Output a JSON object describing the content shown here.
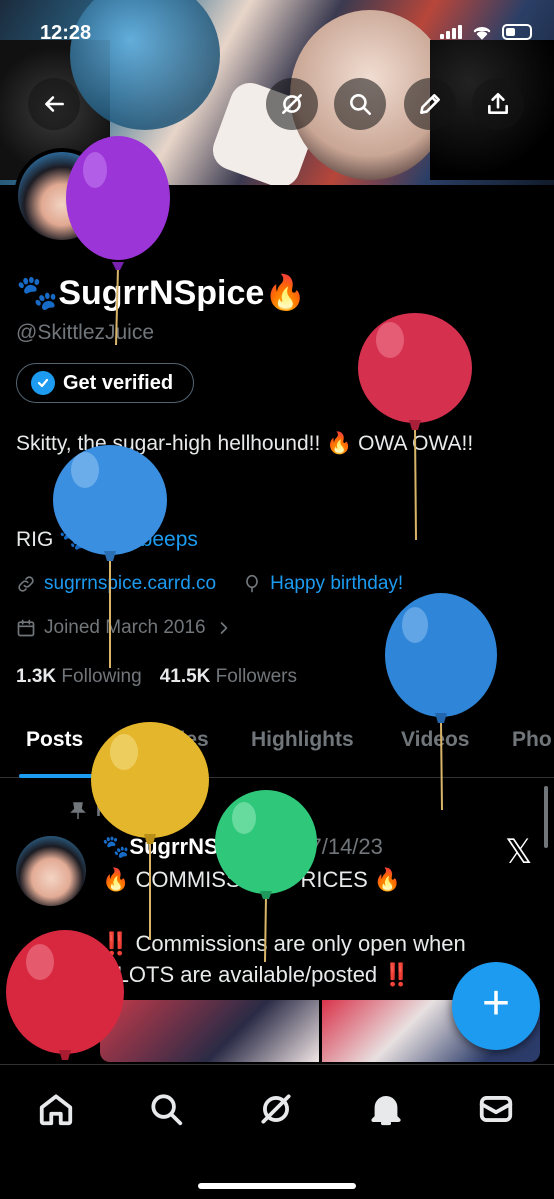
{
  "status_bar": {
    "time": "12:28"
  },
  "profile": {
    "name": "🐾SugrrNSpice🔥",
    "handle": "@SkittlezJuice",
    "verify_label": "Get verified",
    "bio": "Skitty, the sugar-high hellhound!! 🔥 OWA OWA!!",
    "rig_prefix": "RIG 🐾",
    "rig_link": "@belbeeps",
    "website": "sugrrnspice.carrd.co",
    "birthday": "Happy birthday!",
    "joined": "Joined March 2016",
    "following_count": "1.3K",
    "following_label": "Following",
    "followers_count": "41.5K",
    "followers_label": "Followers"
  },
  "tabs": [
    "Posts",
    "Replies",
    "Highlights",
    "Videos",
    "Pho"
  ],
  "post": {
    "pinned_label": "Pinned",
    "author": "🐾SugrrNSpice🔥",
    "date": "· 7/14/23",
    "line1": "🔥 COMMISSION PRICES 🔥",
    "line2_text": " Commissions are only open when SLOTS are available/posted ",
    "alert_glyph": "‼️",
    "x_logo": "𝕏"
  },
  "fab_label": "+",
  "icons": {
    "top": [
      "back-arrow-icon",
      "grok-icon",
      "search-icon",
      "edit-pencil-icon",
      "share-icon"
    ],
    "nav": [
      "home-icon",
      "search-icon",
      "grok-icon",
      "notifications-bell-icon",
      "messages-mail-icon"
    ]
  },
  "balloon_colors": [
    "#9b35d8",
    "#d6304f",
    "#3b8fe0",
    "#2f86d8",
    "#e4b62c",
    "#2fc77a",
    "#d8283f"
  ]
}
